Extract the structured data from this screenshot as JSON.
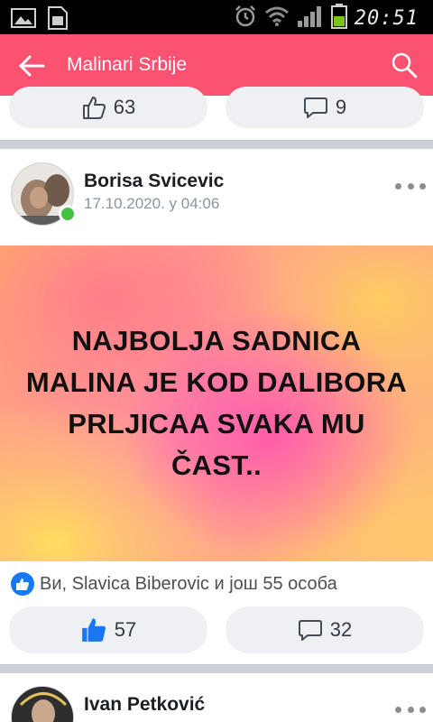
{
  "status_bar": {
    "time": "20:51",
    "icons": [
      "gallery-icon",
      "sim-card-icon",
      "alarm-icon",
      "wifi-icon",
      "signal-icon",
      "battery-icon"
    ]
  },
  "app_bar": {
    "title": "Malinari Srbije",
    "background_color": "#fb5271",
    "icons": [
      "back-arrow-icon",
      "search-icon"
    ]
  },
  "previous_post": {
    "likes": "63",
    "comments": "9"
  },
  "post": {
    "author": "Borisa Svicevic",
    "timestamp": "17.10.2020. у 04:06",
    "online": true,
    "text_lines": [
      "NAJBOLJA SADNICA",
      "MALINA JE KOD DALIBORA",
      "PRLJICAA SVAKA MU",
      "ČAST.."
    ],
    "reactions_summary": "Ви, Slavica Biberovic и још 55 особа",
    "likes": "57",
    "comments": "32",
    "liked_by_me": true,
    "accent_color": "#1877f2"
  },
  "next_post": {
    "author": "Ivan Petković"
  }
}
